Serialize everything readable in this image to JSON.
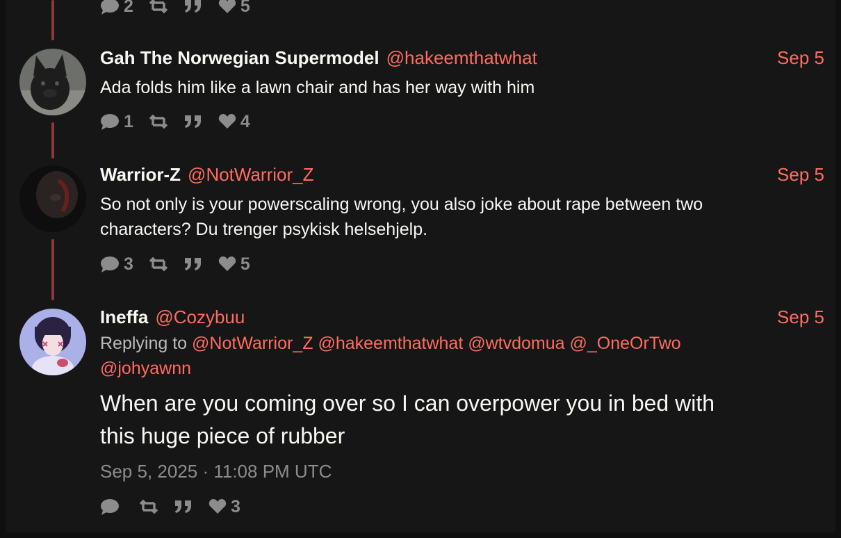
{
  "top_stats": {
    "replies": "2",
    "likes": "5"
  },
  "tweets": [
    {
      "fullname": "Gah The Norwegian Supermodel",
      "handle": "@hakeemthatwhat",
      "date": "Sep 5",
      "text": "Ada folds him like a lawn chair and has her way with him",
      "replies": "1",
      "likes": "4"
    },
    {
      "fullname": "Warrior-Z",
      "handle": "@NotWarrior_Z",
      "date": "Sep 5",
      "text_line1": "So not only is your powerscaling wrong, you also joke about rape between two",
      "text_line2": "characters? Du trenger psykisk helsehjelp.",
      "replies": "3",
      "likes": "5"
    },
    {
      "fullname": "Ineffa",
      "handle": "@Cozybuu",
      "date": "Sep 5",
      "replying_prefix": "Replying to",
      "mentions": [
        "@NotWarrior_Z",
        "@hakeemthatwhat",
        "@wtvdomua",
        "@_OneOrTwo",
        "@johyawnn"
      ],
      "text_line1": "When are you coming over so I can overpower you in bed with",
      "text_line2": "this huge piece of rubber",
      "timestamp": "Sep 5, 2025 · 11:08 PM UTC",
      "replies": "",
      "likes": "3"
    }
  ],
  "colors": {
    "accent": "#ff6c60",
    "thread": "#8b3a3a",
    "background": "#161616",
    "muted": "#8c8c8c"
  },
  "icons": [
    "comment-icon",
    "retweet-icon",
    "quote-icon",
    "heart-icon"
  ]
}
